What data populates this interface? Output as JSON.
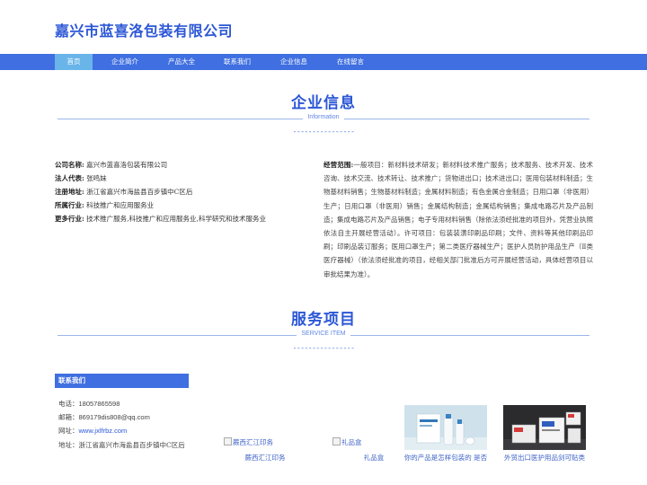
{
  "header": {
    "title": "嘉兴市蓝喜洛包装有限公司"
  },
  "nav": {
    "items": [
      {
        "label": "首页",
        "active": true
      },
      {
        "label": "企业简介"
      },
      {
        "label": "产品大全"
      },
      {
        "label": "联系我们"
      },
      {
        "label": "企业信息"
      },
      {
        "label": "在线留言"
      }
    ]
  },
  "company_section": {
    "title": "企业信息",
    "subtitle": "Information",
    "dashes": "----------------"
  },
  "company_info": {
    "name_label": "公司名称:",
    "name": "嘉兴市蓝喜洛包装有限公司",
    "rep_label": "法人代表:",
    "rep": "张鸣妹",
    "address_label": "注册地址:",
    "address": "浙江省嘉兴市海盐县百步镇中C区后",
    "industry_label": "所属行业:",
    "industry": "科技推广和应用服务业",
    "more_label": "更多行业:",
    "more": "技术推广服务,科技推广和应用服务业,科学研究和技术服务业",
    "scope_label": "经营范围:",
    "scope": "一般项目：新材料技术研发；新材料技术推广服务；技术服务、技术开发、技术咨询、技术交流、技术转让、技术推广；货物进出口；技术进出口；医用包装材料制造；生物基材料销售；生物基材料制造；金属材料制造；有色金属合金制造；日用口罩（非医用）生产；日用口罩（非医用）销售；金属结构制造；金属结构销售；集成电路芯片及产品制造；集成电路芯片及产品销售；电子专用材料销售（除依法须经批准的项目外，凭营业执照依法自主开展经营活动）。许可项目：包装装潢印刷品印刷；文件、资料等其他印刷品印刷；印刷品装订服务；医用口罩生产；第二类医疗器械生产；医护人员防护用品生产（Ⅱ类医疗器械）（依法须经批准的项目，经相关部门批准后方可开展经营活动，具体经营项目以审批结果为准）。"
  },
  "service_section": {
    "title": "服务项目",
    "subtitle": "SERVICE ITEM",
    "dashes": "----------------"
  },
  "contact": {
    "heading": "联系我们",
    "phone_label": "电话：",
    "phone": "18057865598",
    "email_label": "邮箱：",
    "email": "869179dis808@qq.com",
    "site_label": "网址：",
    "site": "www.jxlfrbz.com",
    "address_label": "地址：",
    "address": "浙江省嘉兴市海盐县百步镇中C区后"
  },
  "products": [
    {
      "alt": "蕨西汇江印务",
      "caption": "蕨西汇江印务",
      "image": "broken"
    },
    {
      "alt": "礼品盒",
      "caption": "礼品盒",
      "image": "broken"
    },
    {
      "alt": "你的产品是怎样包装的 是否",
      "caption": "你的产品是怎样包装的 是否",
      "image": "product-photo"
    },
    {
      "alt": "外贸出口医护用品剑可贴类",
      "caption": "外贸出口医护用品剑可贴类",
      "image": "product-photo"
    }
  ],
  "colors": {
    "brand": "#2c57d6",
    "nav_bg": "#3f6fe0",
    "nav_active": "#69b5ea",
    "rule": "#9cb6ee"
  }
}
